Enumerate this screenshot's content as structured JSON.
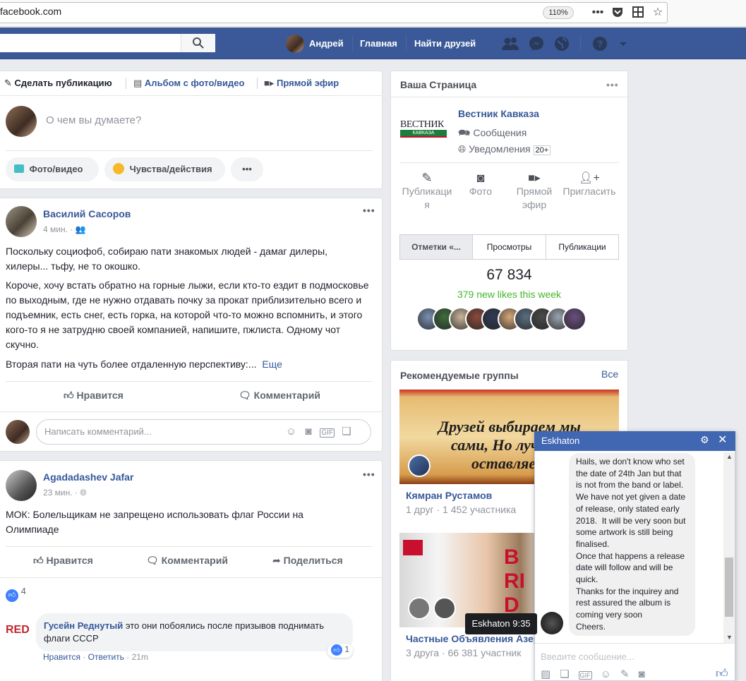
{
  "browser": {
    "url": "facebook.com",
    "zoom": "110%",
    "menu_icon": "ellipsis-icon",
    "pocket_icon": "pocket-icon",
    "reader_icon": "reader-icon",
    "bookmark_icon": "star-icon"
  },
  "nav": {
    "user_name": "Андрей",
    "home": "Главная",
    "find_friends": "Найти друзей"
  },
  "composer": {
    "tab_publish": "Сделать публикацию",
    "tab_album": "Альбом с фото/видео",
    "tab_live": "Прямой эфир",
    "placeholder": "О чем вы думаете?",
    "btn_photo": "Фото/видео",
    "btn_feeling": "Чувства/действия",
    "btn_more": "•••"
  },
  "post1": {
    "author": "Василий Сасоров",
    "time": "4 мин.",
    "para1": "Поскольку социофоб, собираю пати знакомых людей - дамаг дилеры, хилеры... тьфу, не то окошко.",
    "para2": "Короче, хочу встать обратно на горные лыжи, если кто-то ездит в подмосковье по выходным, где не нужно отдавать почку за прокат приблизительно всего и подъемник, есть снег, есть горка, на которой что-то можно вспомнить, и этого кого-то я не затрудню своей компанией, напишите, пжлиста. Одному чот скучно.",
    "para3": "Вторая пати на чуть более отдаленную перспективу:...",
    "more": "Еще",
    "like": "Нравится",
    "comment": "Комментарий",
    "comment_placeholder": "Написать комментарий..."
  },
  "post2": {
    "author": "Agadadashev Jafar",
    "time": "23 мин.",
    "text": "МОК: Болельщикам не запрещено использовать флаг России на Олимпиаде",
    "like": "Нравится",
    "comment": "Комментарий",
    "share": "Поделиться",
    "likes_count": "4",
    "reply_author": "Гусейн Реднутый",
    "reply_text": "это они побоялись после призывов поднимать флаги СССР",
    "reply_likes": "1",
    "reply_like": "Нравится",
    "reply_answer": "Ответить",
    "reply_time": "21m"
  },
  "page_widget": {
    "title": "Ваша Страница",
    "page_name": "Вестник Кавказа",
    "logo_top": "ВЕСТНИК",
    "logo_bottom": "КАВКАЗА",
    "messages": "Сообщения",
    "notifications": "Уведомления",
    "notif_count": "20+",
    "act_publish": "Публикация",
    "act_photo": "Фото",
    "act_live": "Прямой эфир",
    "act_invite": "Пригласить",
    "tab1": "Отметки «...",
    "tab2": "Просмотры",
    "tab3": "Публикации",
    "likes_total": "67 834",
    "likes_new": "379 new likes this week"
  },
  "groups": {
    "title": "Рекомендуемые группы",
    "see_all": "Все",
    "g1_banner": "Друзей выбираем мы сами, Но лучших оставляет",
    "g1_name": "Кямран Рустамов",
    "g1_meta": "1 друг · 1 452 участника",
    "g2_name": "Частные Объявления Азерб",
    "g2_meta": "3 друга · 66 381 участник",
    "g2_banner_red": "BRI DA"
  },
  "chat": {
    "title": "Eskhaton",
    "message": "Hails, we don't know who set the date of 24th Jan but that is not from the band or label.  We have not yet given a date of release, only stated early 2018.  It will be very soon but some artwork is still being finalised.\nOnce that happens a release date will follow and will be quick.\nThanks for the inquirey and rest assured the album is coming very soon\nCheers.",
    "tooltip": "Eskhaton 9:35",
    "input_placeholder": "Введите сообщение..."
  },
  "colors": {
    "fb_blue": "#3b5998",
    "chat_blue": "#4267b2",
    "link": "#365899",
    "green": "#42b72a"
  }
}
